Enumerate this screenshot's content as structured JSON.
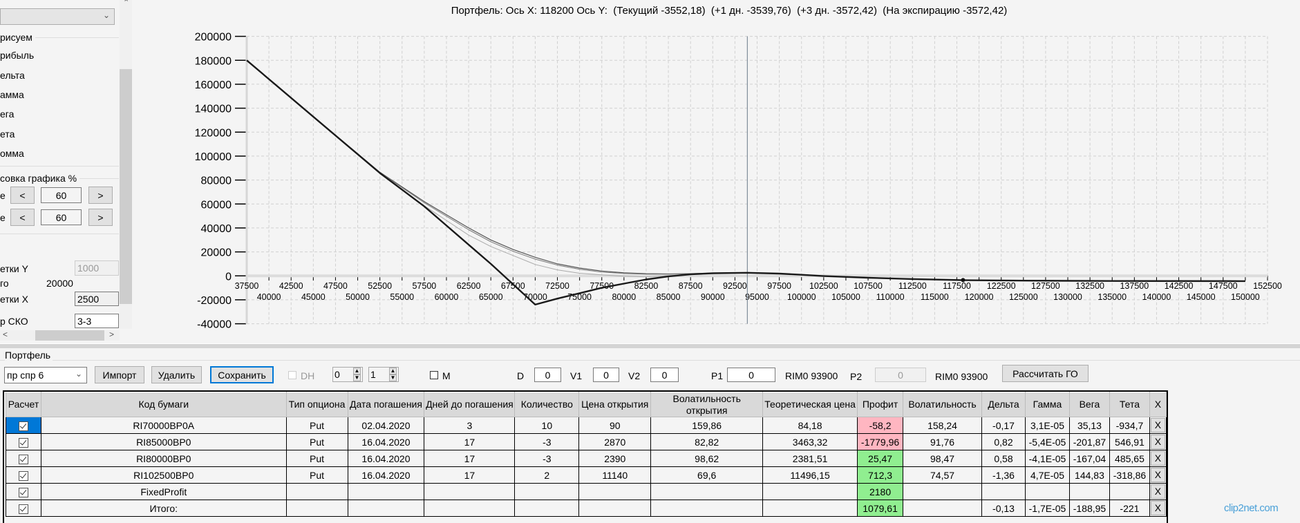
{
  "left_panel": {
    "top_combo_value": "",
    "draw_group_label": "рисуем",
    "draw_items": [
      "рибыль",
      "ельта",
      "амма",
      "ега",
      "ета",
      "омма"
    ],
    "scale_group_label": "совка графика %",
    "scale_rows": [
      {
        "label": "е",
        "dec": "<",
        "value": "60",
        "inc": ">"
      },
      {
        "label": "е",
        "dec": "<",
        "value": "60",
        "inc": ">"
      }
    ],
    "grid_y_label": "етки Y",
    "grid_y_value": "1000",
    "step_label": "го",
    "step_value": "20000",
    "grid_x_label": "етки X",
    "grid_x_value": "2500",
    "sko_label": "р СКО",
    "sko_value": "3-3",
    "hscroll_left": "<",
    "hscroll_right": ">"
  },
  "chart_title": "Портфель: Ось X: 118200 Ось Y:  (Текущий -3552,18)  (+1 дн. -3539,76)  (+3 дн. -3572,42)  (На экспирацию -3572,42)",
  "chart_data": {
    "type": "line",
    "title": "Портфель: Ось X: 118200 Ось Y:  (Текущий -3552,18)  (+1 дн. -3539,76)  (+3 дн. -3572,42)  (На экспирацию -3572,42)",
    "xlim": [
      37500,
      152500
    ],
    "ylim": [
      -40000,
      200000
    ],
    "grid": true,
    "x_ticks_row1": [
      37500,
      42500,
      47500,
      52500,
      57500,
      62500,
      67500,
      72500,
      77500,
      82500,
      87500,
      92500,
      97500,
      102500,
      107500,
      112500,
      117500,
      122500,
      127500,
      132500,
      137500,
      142500,
      147500,
      152500
    ],
    "x_ticks_row2": [
      40000,
      45000,
      50000,
      55000,
      60000,
      65000,
      70000,
      75000,
      80000,
      85000,
      90000,
      95000,
      100000,
      105000,
      110000,
      115000,
      120000,
      125000,
      130000,
      135000,
      140000,
      145000,
      150000
    ],
    "y_ticks": [
      200000,
      180000,
      160000,
      140000,
      120000,
      100000,
      80000,
      60000,
      40000,
      20000,
      0,
      -20000,
      -40000
    ],
    "current_price_line_x": 93900,
    "cursor_point": {
      "x": 118200,
      "y": -3552.18
    },
    "x": [
      37500,
      45000,
      52500,
      57500,
      62500,
      65000,
      67500,
      70000,
      72500,
      75000,
      77500,
      80000,
      82500,
      85000,
      87500,
      90000,
      93900,
      97500,
      100000,
      102500,
      107500,
      112500,
      118200,
      125000,
      135000,
      150000
    ],
    "series": [
      {
        "color": "#555555",
        "width": 1.2,
        "values": [
          180000,
          133000,
          86500,
          62000,
          40000,
          30000,
          22000,
          15500,
          10000,
          6500,
          4000,
          2500,
          1800,
          1600,
          1800,
          2300,
          2600,
          2000,
          1000,
          0,
          -1500,
          -2600,
          -3552.18,
          -4000,
          -4300,
          -4400
        ]
      },
      {
        "color": "#777777",
        "width": 1,
        "values": [
          180000,
          133000,
          86300,
          61000,
          38500,
          28500,
          20500,
          14000,
          9000,
          5500,
          3200,
          2000,
          1500,
          1500,
          1800,
          2300,
          2600,
          2000,
          1000,
          0,
          -1500,
          -2600,
          -3539.76,
          -4000,
          -4300,
          -4400
        ]
      },
      {
        "color": "#aaaaaa",
        "width": 1,
        "values": [
          180000,
          132900,
          86000,
          58500,
          34000,
          24500,
          17000,
          9500,
          5000,
          2200,
          800,
          -300,
          -800,
          200,
          1400,
          2200,
          2600,
          1900,
          900,
          -200,
          -1600,
          -2700,
          -3572.42,
          -4000,
          -4300,
          -4400
        ]
      },
      {
        "color": "#1a1a1a",
        "width": 2.4,
        "values": [
          180000,
          132900,
          85850,
          58000,
          26000,
          10000,
          -7000,
          -24000,
          -19000,
          -14500,
          -10000,
          -6500,
          -3000,
          -500,
          1300,
          2200,
          2600,
          1900,
          900,
          -200,
          -1600,
          -2700,
          -3572.42,
          -4000,
          -4300,
          -4400
        ]
      }
    ]
  },
  "portfolio": {
    "group_label": "Портфель",
    "combo_value": "пр спр 6",
    "import_label": "Импорт",
    "delete_label": "Удалить",
    "save_label": "Сохранить",
    "dh_label": "DH",
    "spin1_value": "0",
    "spin2_value": "1",
    "m_label": "M",
    "d_label": "D",
    "d_value": "0",
    "v1_label": "V1",
    "v1_value": "0",
    "v2_label": "V2",
    "v2_value": "0",
    "p1_label": "P1",
    "p1_value": "0",
    "p1_ticker": "RIM0 93900",
    "p2_label": "P2",
    "p2_value": "0",
    "p2_ticker": "RIM0 93900",
    "calc_go_label": "Рассчитать ГО"
  },
  "table": {
    "columns": [
      "Расчет",
      "Код бумаги",
      "Тип опциона",
      "Дата погашения",
      "Дней до погашения",
      "Количество",
      "Цена открытия",
      "Волатильность открытия",
      "Теоретическая цена",
      "Профит",
      "Волатильность",
      "Дельта",
      "Гамма",
      "Вега",
      "Тета",
      "X"
    ],
    "rows": [
      {
        "checked": true,
        "selected": true,
        "cells": [
          "RI70000BP0A",
          "Put",
          "02.04.2020",
          "3",
          "10",
          "90",
          "159,86",
          "84,18",
          "-58,2",
          "158,24",
          "-0,17",
          "3,1E-05",
          "35,13",
          "-934,7"
        ],
        "profit_color": "#ffb6c1",
        "x": "X"
      },
      {
        "checked": true,
        "cells": [
          "RI85000BP0",
          "Put",
          "16.04.2020",
          "17",
          "-3",
          "2870",
          "82,82",
          "3463,32",
          "-1779,96",
          "91,76",
          "0,82",
          "-5,4E-05",
          "-201,87",
          "546,91"
        ],
        "profit_color": "#ffb6c1",
        "x": "X"
      },
      {
        "checked": true,
        "cells": [
          "RI80000BP0",
          "Put",
          "16.04.2020",
          "17",
          "-3",
          "2390",
          "98,62",
          "2381,51",
          "25,47",
          "98,47",
          "0,58",
          "-4,1E-05",
          "-167,04",
          "485,65"
        ],
        "profit_color": "#90ee90",
        "x": "X"
      },
      {
        "checked": true,
        "cells": [
          "RI102500BP0",
          "Put",
          "16.04.2020",
          "17",
          "2",
          "11140",
          "69,6",
          "11496,15",
          "712,3",
          "74,57",
          "-1,36",
          "4,7E-05",
          "144,83",
          "-318,86"
        ],
        "profit_color": "#90ee90",
        "x": "X"
      },
      {
        "checked": true,
        "cells": [
          "FixedProfit",
          "",
          "",
          "",
          "",
          "",
          "",
          "",
          "2180",
          "",
          "",
          "",
          "",
          ""
        ],
        "profit_color": "#90ee90",
        "x": "X"
      },
      {
        "checked": true,
        "cells": [
          "Итого:",
          "",
          "",
          "",
          "",
          "",
          "",
          "",
          "1079,61",
          "",
          "-0,13",
          "-1,7E-05",
          "-188,95",
          "-221"
        ],
        "profit_color": "#90ee90",
        "x": "X"
      }
    ]
  },
  "watermark": "clip2net.com"
}
